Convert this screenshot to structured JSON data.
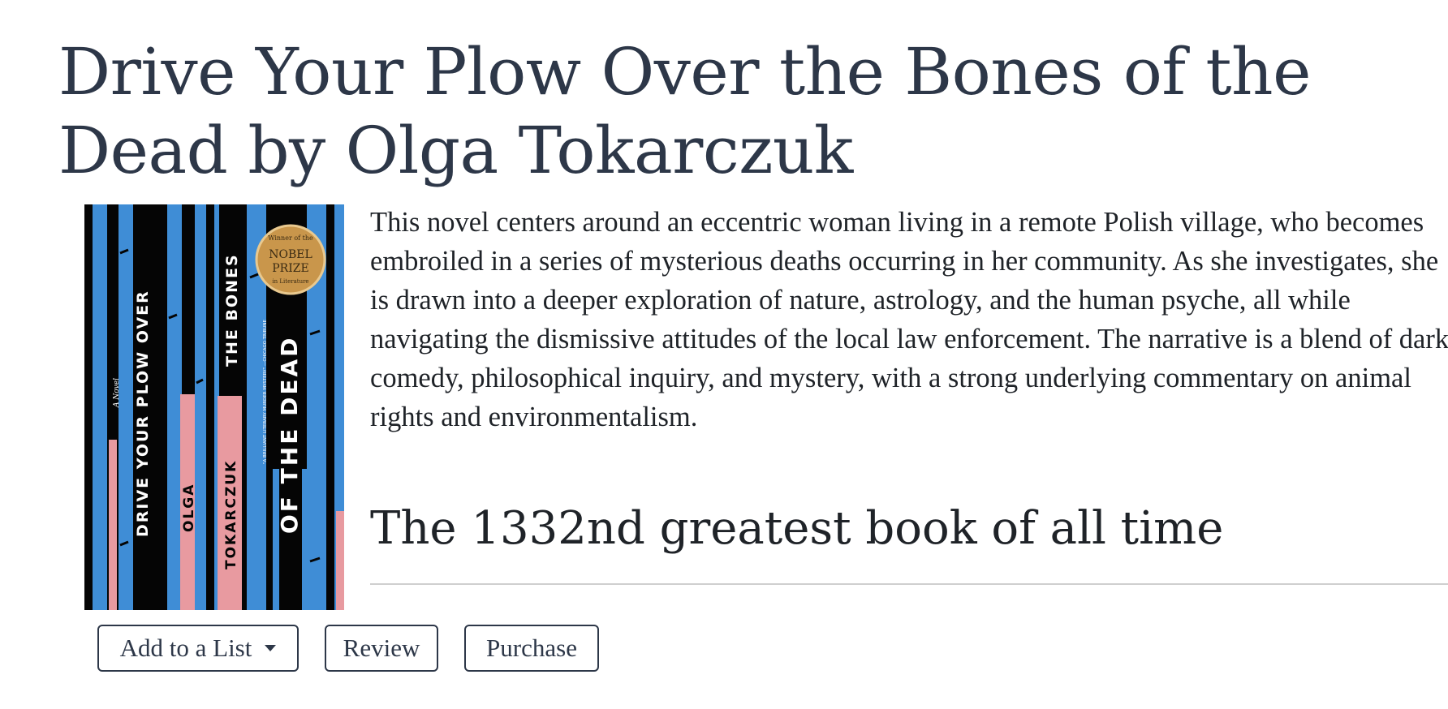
{
  "book": {
    "title": "Drive Your Plow Over the Bones of the Dead by Olga Tokarczuk",
    "description": "This novel centers around an eccentric woman living in a remote Polish village, who becomes embroiled in a series of mysterious deaths occurring in her community. As she investigates, she is drawn into a deeper exploration of nature, astrology, and the human psyche, all while navigating the dismissive attitudes of the local law enforcement. The narrative is a blend of dark comedy, philosophical inquiry, and mystery, with a strong underlying commentary on animal rights and environmentalism.",
    "rank_text": "The 1332nd greatest book of all time"
  },
  "cover": {
    "lines": [
      "DRIVE YOUR PLOW OVER",
      "THE BONES",
      "OF THE DEAD"
    ],
    "author_first": "OLGA",
    "author_last": "TOKARCZUK",
    "tag": "A Novel",
    "blurb": "\"A BRILLIANT LITERARY MURDER MYSTERY\" —CHICAGO TRIBUNE",
    "badge_top": "Winner of the",
    "badge_main_1": "NOBEL",
    "badge_main_2": "PRIZE",
    "badge_bottom": "in Literature",
    "colors": {
      "sky": "#3f8dd6",
      "trunk": "#050505",
      "pink": "#e89aa0",
      "badge": "#c9964b"
    }
  },
  "actions": {
    "add_to_list": "Add to a List",
    "review": "Review",
    "purchase": "Purchase"
  },
  "icons": {
    "dropdown": "caret-down-icon"
  }
}
